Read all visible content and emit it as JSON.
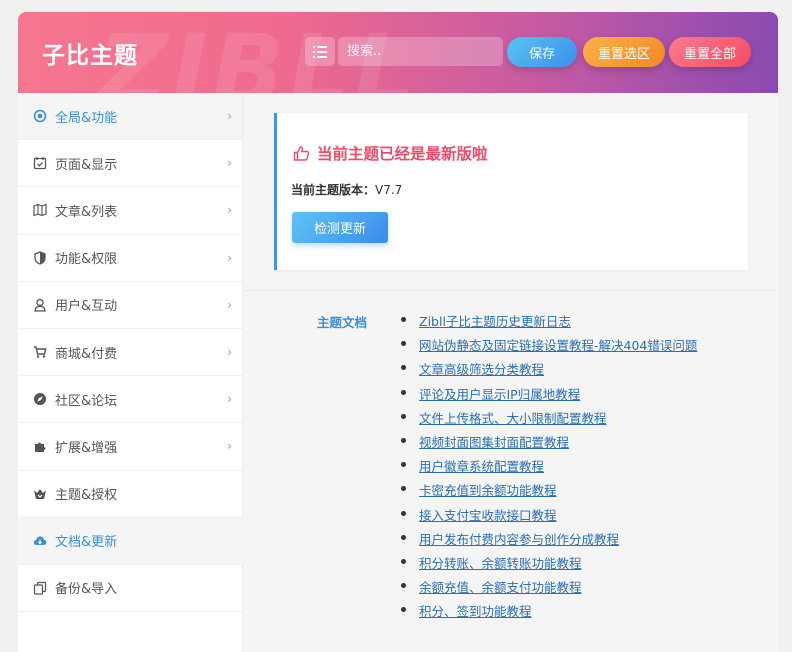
{
  "header": {
    "brand": "子比主题",
    "watermark": "ZIBLL",
    "search_placeholder": "搜索..",
    "save_label": "保存",
    "reset_section_label": "重置选区",
    "reset_all_label": "重置全部"
  },
  "sidebar": {
    "items": [
      {
        "label": "全局&功能",
        "icon": "target-icon",
        "has_arrow": true
      },
      {
        "label": "页面&显示",
        "icon": "calendar-check-icon",
        "has_arrow": true
      },
      {
        "label": "文章&列表",
        "icon": "map-icon",
        "has_arrow": true
      },
      {
        "label": "功能&权限",
        "icon": "shield-icon",
        "has_arrow": true
      },
      {
        "label": "用户&互动",
        "icon": "user-icon",
        "has_arrow": true
      },
      {
        "label": "商城&付费",
        "icon": "cart-icon",
        "has_arrow": true
      },
      {
        "label": "社区&论坛",
        "icon": "compass-icon",
        "has_arrow": true
      },
      {
        "label": "扩展&增强",
        "icon": "puzzle-icon",
        "has_arrow": true
      },
      {
        "label": "主题&授权",
        "icon": "logo-icon",
        "has_arrow": false
      },
      {
        "label": "文档&更新",
        "icon": "cloud-download-icon",
        "has_arrow": false
      },
      {
        "label": "备份&导入",
        "icon": "copy-icon",
        "has_arrow": false
      }
    ]
  },
  "update_card": {
    "title": "当前主题已经是最新版啦",
    "version_label": "当前主题版本：",
    "version_value": "V7.7",
    "check_button": "检测更新"
  },
  "docs": {
    "label": "主题文档",
    "links": [
      "Zibll子比主题历史更新日志",
      "网站伪静态及固定链接设置教程-解决404错误问题",
      "文章高级筛选分类教程",
      "评论及用户显示IP归属地教程",
      "文件上传格式、大小限制配置教程",
      "视频封面图集封面配置教程",
      "用户徽章系统配置教程",
      "卡密充值到余额功能教程",
      "接入支付宝收款接口教程",
      "用户发布付费内容参与创作分成教程",
      "积分转账、余额转账功能教程",
      "余额充值、余额支付功能教程",
      "积分、签到功能教程"
    ]
  },
  "colors": {
    "accent": "#3a8fd9",
    "title_red": "#f04c6a"
  }
}
